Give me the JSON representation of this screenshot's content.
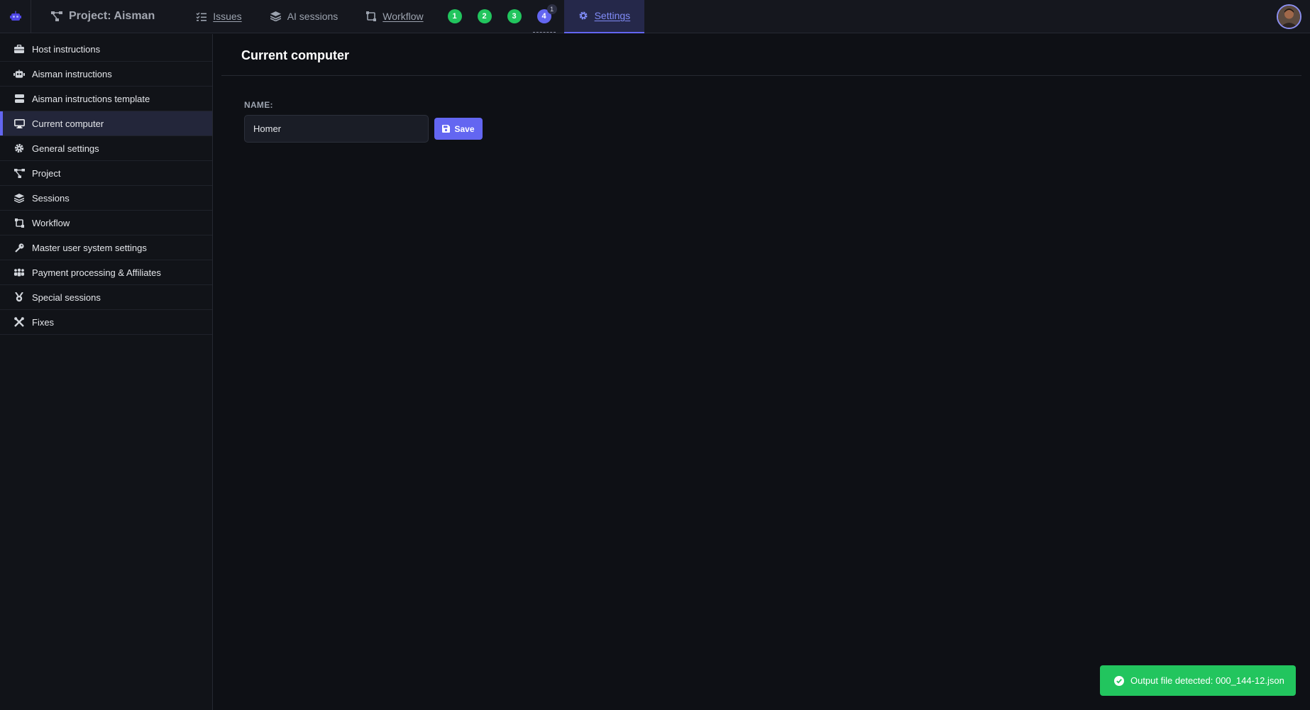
{
  "navbar": {
    "project_label": "Project: Aisman",
    "issues_label": "Issues",
    "ai_sessions_label": "AI sessions",
    "workflow_label": "Workflow",
    "badges": [
      "1",
      "2",
      "3",
      "4"
    ],
    "badge4_count": "1",
    "settings_label": "Settings"
  },
  "sidebar": {
    "items": [
      {
        "label": "Host instructions",
        "icon": "briefcase-icon"
      },
      {
        "label": "Aisman instructions",
        "icon": "robot-icon"
      },
      {
        "label": "Aisman instructions template",
        "icon": "server-icon"
      },
      {
        "label": "Current computer",
        "icon": "desktop-icon"
      },
      {
        "label": "General settings",
        "icon": "gear-icon"
      },
      {
        "label": "Project",
        "icon": "project-diagram-icon"
      },
      {
        "label": "Sessions",
        "icon": "layers-icon"
      },
      {
        "label": "Workflow",
        "icon": "workflow-icon"
      },
      {
        "label": "Master user system settings",
        "icon": "key-icon"
      },
      {
        "label": "Payment processing & Affiliates",
        "icon": "people-icon"
      },
      {
        "label": "Special sessions",
        "icon": "medal-icon"
      },
      {
        "label": "Fixes",
        "icon": "tools-icon"
      }
    ],
    "active_index": 3
  },
  "main": {
    "title": "Current computer",
    "name_label": "NAME:",
    "name_value": "Homer",
    "save_label": "Save"
  },
  "toast": {
    "message": "Output file detected: 000_144-12.json"
  },
  "colors": {
    "accent": "#6366f1",
    "success": "#22c55e",
    "background": "#0e1015"
  }
}
